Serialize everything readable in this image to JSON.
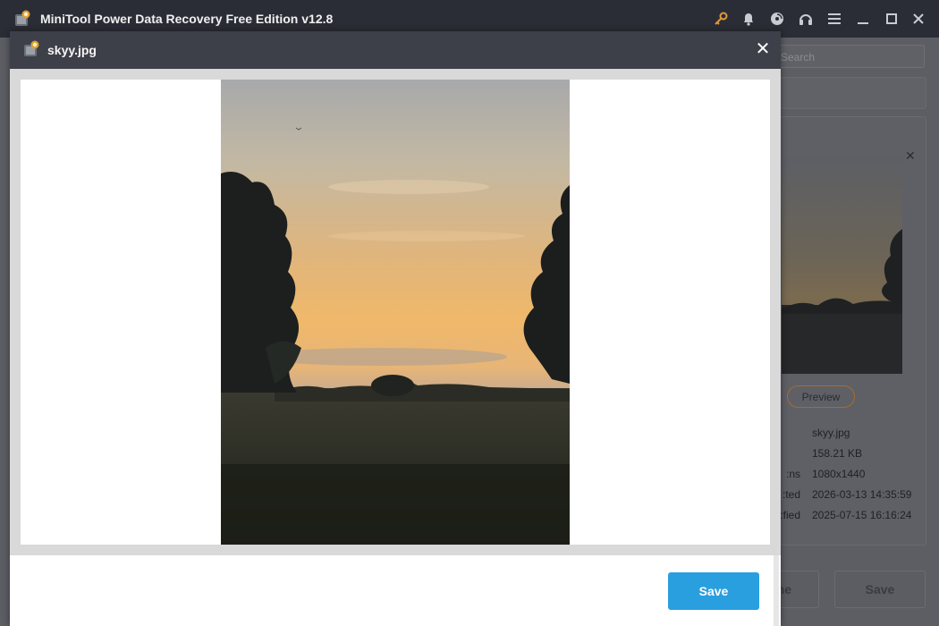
{
  "app": {
    "title": "MiniTool Power Data Recovery Free Edition v12.8",
    "icons": [
      "key-icon",
      "bell-icon",
      "disc-icon",
      "headset-icon",
      "menu-icon",
      "minimize-icon",
      "maximize-icon",
      "close-icon"
    ]
  },
  "background": {
    "search_placeholder": "Search",
    "preview_button": "Preview",
    "file_info": [
      {
        "label": "",
        "value": "skyy.jpg"
      },
      {
        "label": "",
        "value": "158.21 KB"
      },
      {
        "label": "ns:",
        "value": "1080x1440"
      },
      {
        "label": "ted:",
        "value": "2026-03-13 14:35:59"
      },
      {
        "label": "fied:",
        "value": "2025-07-15 16:16:24"
      }
    ],
    "button_partial": "ne",
    "save_button": "Save"
  },
  "dialog": {
    "title": "skyy.jpg",
    "close_glyph": "✕",
    "save_button": "Save"
  },
  "colors": {
    "accent": "#2a9fe0",
    "titlebar": "#2b2d36",
    "dialog_header": "#3e4049",
    "preview_border": "#a86a30"
  }
}
